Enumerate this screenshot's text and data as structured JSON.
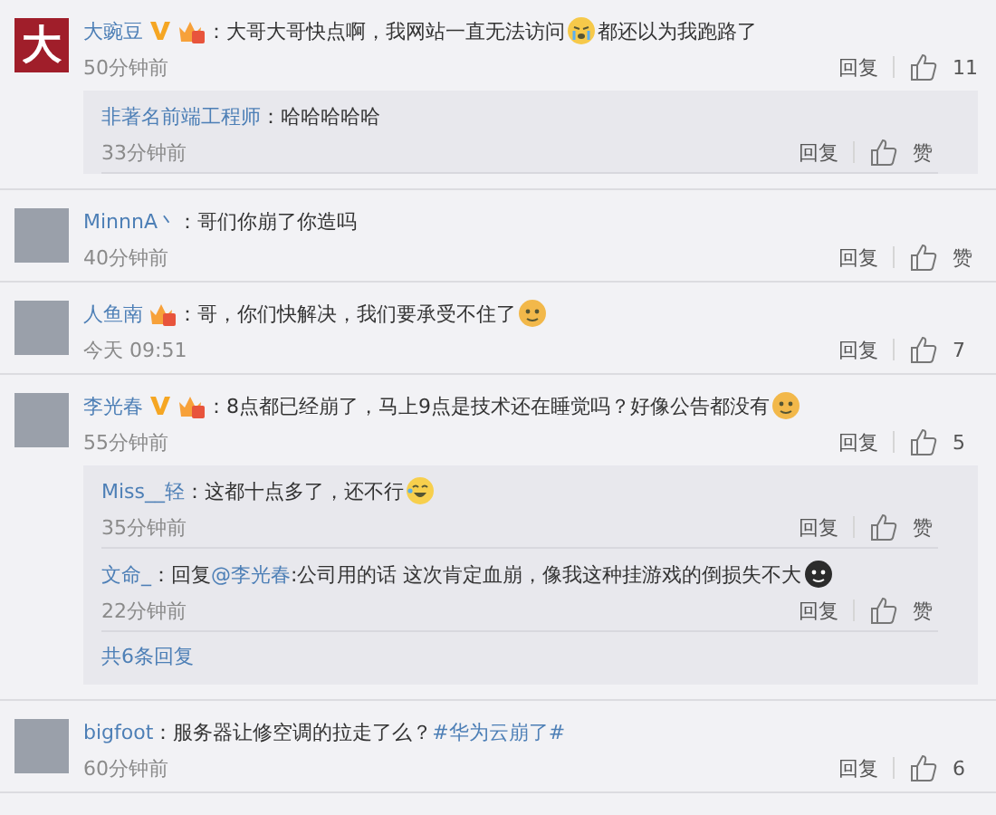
{
  "comments": [
    {
      "avatar": {
        "kind": "logo",
        "text": "大"
      },
      "name": "大豌豆",
      "verified": true,
      "member": true,
      "content": [
        {
          "kind": "text",
          "text": "：大哥大哥快点啊，我网站一直无法访问"
        },
        {
          "kind": "crying"
        },
        {
          "kind": "text",
          "text": "都还以为我跑路了"
        }
      ],
      "time": "50分钟前",
      "reply_label": "回复",
      "likes": "11",
      "replies": [
        {
          "name": "非著名前端工程师",
          "content": [
            {
              "kind": "text",
              "text": "：哈哈哈哈哈"
            }
          ],
          "time": "33分钟前",
          "reply_label": "回复",
          "likes": "赞"
        }
      ]
    },
    {
      "avatar": {
        "kind": "photo"
      },
      "name": "MinnnA丶",
      "verified": false,
      "member": false,
      "content": [
        {
          "kind": "text",
          "text": "：哥们你崩了你造吗"
        }
      ],
      "time": "40分钟前",
      "reply_label": "回复",
      "likes": "赞"
    },
    {
      "avatar": {
        "kind": "photo"
      },
      "name": "人鱼南",
      "verified": false,
      "member": true,
      "content": [
        {
          "kind": "text",
          "text": "：哥，你们快解决，我们要承受不住了"
        },
        {
          "kind": "doll"
        }
      ],
      "time": "今天 09:51",
      "reply_label": "回复",
      "likes": "7"
    },
    {
      "avatar": {
        "kind": "photo"
      },
      "name": "李光春",
      "verified": true,
      "member": true,
      "content": [
        {
          "kind": "text",
          "text": "：8点都已经崩了，马上9点是技术还在睡觉吗？好像公告都没有"
        },
        {
          "kind": "doll"
        }
      ],
      "time": "55分钟前",
      "reply_label": "回复",
      "likes": "5",
      "replies": [
        {
          "name": "Miss__轻",
          "content": [
            {
              "kind": "text",
              "text": "：这都十点多了，还不行"
            },
            {
              "kind": "laughing"
            }
          ],
          "time": "35分钟前",
          "reply_label": "回复",
          "likes": "赞"
        },
        {
          "name": "文命_",
          "content": [
            {
              "kind": "text",
              "text": "：回复"
            },
            {
              "kind": "link",
              "text": "@李光春"
            },
            {
              "kind": "text",
              "text": ":公司用的话 这次肯定血崩，像我这种挂游戏的倒损失不大"
            },
            {
              "kind": "dark"
            }
          ],
          "time": "22分钟前",
          "reply_label": "回复",
          "likes": "赞"
        }
      ],
      "more_replies": "共6条回复"
    },
    {
      "avatar": {
        "kind": "photo"
      },
      "name": "bigfoot",
      "verified": false,
      "member": false,
      "content": [
        {
          "kind": "text",
          "text": "：服务器让修空调的拉走了么？"
        },
        {
          "kind": "link",
          "text": "#华为云崩了#"
        }
      ],
      "time": "60分钟前",
      "reply_label": "回复",
      "likes": "6"
    }
  ]
}
